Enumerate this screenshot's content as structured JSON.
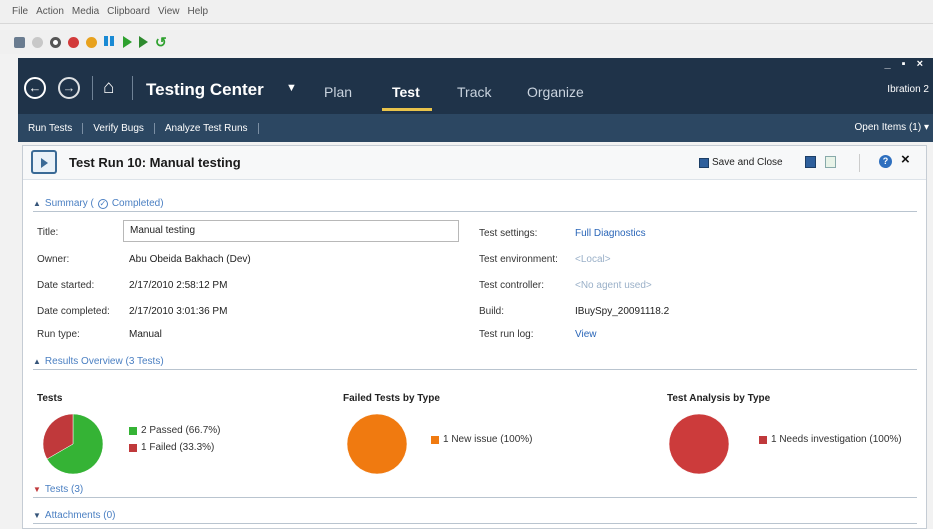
{
  "vm_menu": {
    "items": [
      "File",
      "Action",
      "Media",
      "Clipboard",
      "View",
      "Help"
    ]
  },
  "header": {
    "back_icon": "back-arrow-icon",
    "forward_icon": "forward-arrow-icon",
    "home_icon": "home-icon",
    "app_name": "Testing Center",
    "tabs": [
      {
        "label": "Plan",
        "active": false
      },
      {
        "label": "Test",
        "active": true
      },
      {
        "label": "Track",
        "active": false
      },
      {
        "label": "Organize",
        "active": false
      }
    ],
    "user": "Ibration 2",
    "accent": "#e8c34b",
    "bg": "#1f3349"
  },
  "subnav": {
    "items": [
      "Run Tests",
      "Verify Bugs",
      "Analyze Test Runs"
    ],
    "open_items": "Open Items (1)"
  },
  "run": {
    "title": "Test Run 10: Manual testing",
    "save_close": "Save and Close"
  },
  "summary": {
    "header": "Summary (",
    "status": "Completed)",
    "fields_left": [
      {
        "label": "Title:",
        "value": "Manual testing"
      },
      {
        "label": "Owner:",
        "value": "Abu Obeida Bakhach (Dev)"
      },
      {
        "label": "Date started:",
        "value": "2/17/2010 2:58:12 PM"
      },
      {
        "label": "Date completed:",
        "value": "2/17/2010 3:01:36 PM"
      },
      {
        "label": "Run type:",
        "value": "Manual"
      }
    ],
    "fields_right": [
      {
        "label": "Test settings:",
        "value": "Full Diagnostics"
      },
      {
        "label": "Test environment:",
        "value": "<Local>"
      },
      {
        "label": "Test controller:",
        "value": "<No agent used>"
      },
      {
        "label": "Build:",
        "value": "IBuySpy_20091118.2"
      },
      {
        "label": "Test run log:",
        "value": "View"
      }
    ]
  },
  "results": {
    "header": "Results Overview (3 Tests)",
    "charts": [
      {
        "title": "Tests",
        "legend": [
          "2 Passed (66.7%)",
          "1 Failed (33.3%)"
        ]
      },
      {
        "title": "Failed Tests by Type",
        "legend": [
          "1 New issue (100%)"
        ]
      },
      {
        "title": "Test Analysis by Type",
        "legend": [
          "1 Needs investigation (100%)"
        ]
      }
    ]
  },
  "chart_data": [
    {
      "type": "pie",
      "title": "Tests",
      "categories": [
        "Passed",
        "Failed"
      ],
      "values": [
        2,
        1
      ],
      "colors": [
        "#35b335",
        "#c0393b"
      ]
    },
    {
      "type": "pie",
      "title": "Failed Tests by Type",
      "categories": [
        "New issue"
      ],
      "values": [
        1
      ],
      "colors": [
        "#f07a10"
      ]
    },
    {
      "type": "pie",
      "title": "Test Analysis by Type",
      "categories": [
        "Needs investigation"
      ],
      "values": [
        1
      ],
      "colors": [
        "#cc3b3b"
      ]
    }
  ],
  "sections": {
    "tests": "Tests (3)",
    "attachments": "Attachments (0)"
  }
}
